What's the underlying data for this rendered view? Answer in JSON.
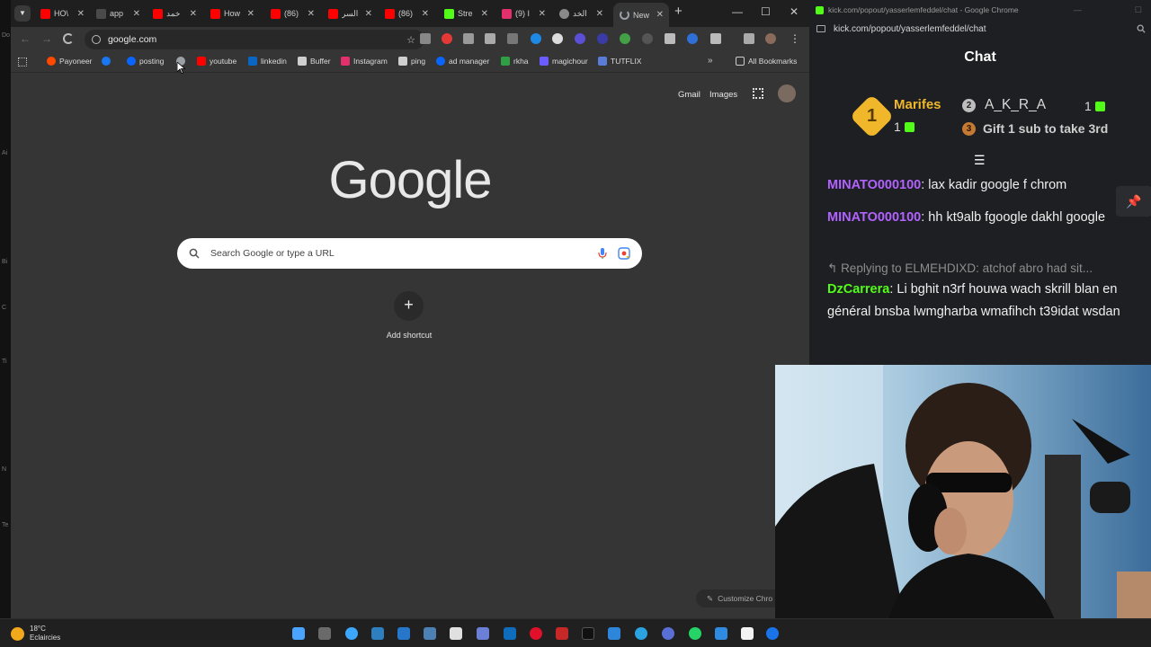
{
  "edge_labels": [
    "Do",
    "Ai",
    "Bi",
    "C",
    "Ti",
    "N",
    "Te"
  ],
  "browser": {
    "tabs": [
      {
        "label": "HO\\",
        "color": "#ff0000"
      },
      {
        "label": "app",
        "color": "#4a4a4a"
      },
      {
        "label": "خمد",
        "color": "#ff0000"
      },
      {
        "label": "How",
        "color": "#ff0000"
      },
      {
        "label": "(86)",
        "color": "#ff0000"
      },
      {
        "label": "السر",
        "color": "#ff0000"
      },
      {
        "label": "(86)",
        "color": "#ff0000"
      },
      {
        "label": "Stre",
        "color": "#53fc18"
      },
      {
        "label": "(9) I",
        "color": "#e1306c"
      },
      {
        "label": "الخد",
        "color": "#8a8a8a"
      },
      {
        "label": "New",
        "color": "#9aa0a6"
      }
    ],
    "url": "google.com",
    "bookmarks": [
      {
        "label": "Payoneer",
        "color": "#ff4800"
      },
      {
        "label": "",
        "color": "#1877f2"
      },
      {
        "label": "posting",
        "color": "#0866ff"
      },
      {
        "label": "",
        "color": "#9aa0a6"
      },
      {
        "label": "youtube",
        "color": "#ff0000"
      },
      {
        "label": "linkedin",
        "color": "#0a66c2"
      },
      {
        "label": "Buffer",
        "color": "#cfcfcf"
      },
      {
        "label": "Instagram",
        "color": "#e1306c"
      },
      {
        "label": "ping",
        "color": "#cfcfcf"
      },
      {
        "label": "ad manager",
        "color": "#0866ff"
      },
      {
        "label": "rkha",
        "color": "#2ea043"
      },
      {
        "label": "magichour",
        "color": "#6b5cff"
      },
      {
        "label": "TUTFLIX",
        "color": "#5a7bd6"
      }
    ],
    "all_bookmarks": "All Bookmarks",
    "page": {
      "logo": "Google",
      "gmail": "Gmail",
      "images": "Images",
      "search_placeholder": "Search Google or type a URL",
      "add_shortcut": "Add shortcut",
      "customize": "Customize Chro"
    }
  },
  "chat_window": {
    "title": "kick.com/popout/yasserlemfeddel/chat - Google Chrome",
    "url": "kick.com/popout/yasserlemfeddel/chat",
    "header": "Chat",
    "leaderboard": {
      "first": {
        "rank": "1",
        "name": "Marifes",
        "count": "1"
      },
      "second": {
        "rank": "2",
        "name": "A_K_R_A",
        "count": "1"
      },
      "third": {
        "rank": "3",
        "text": "Gift 1 sub to take 3rd"
      }
    },
    "messages": [
      {
        "user": "MINATO000100",
        "text": "lax kadir google f chrom",
        "color": "#b162ff"
      },
      {
        "user": "MINATO000100",
        "text": "hh kt9alb fgoogle dakhl google",
        "color": "#b162ff"
      },
      {
        "user": "DzCarrera",
        "text": "Li bghit n3rf houwa wach skrill blan en général bnsba lwmgharba wmafihch t39idat wsdan",
        "color": "#53fc18"
      }
    ],
    "reply": "Replying to ELMEHDIXD: atchof abro had sit..."
  },
  "taskbar": {
    "weather_temp": "18°C",
    "weather_desc": "Eclaircies"
  }
}
